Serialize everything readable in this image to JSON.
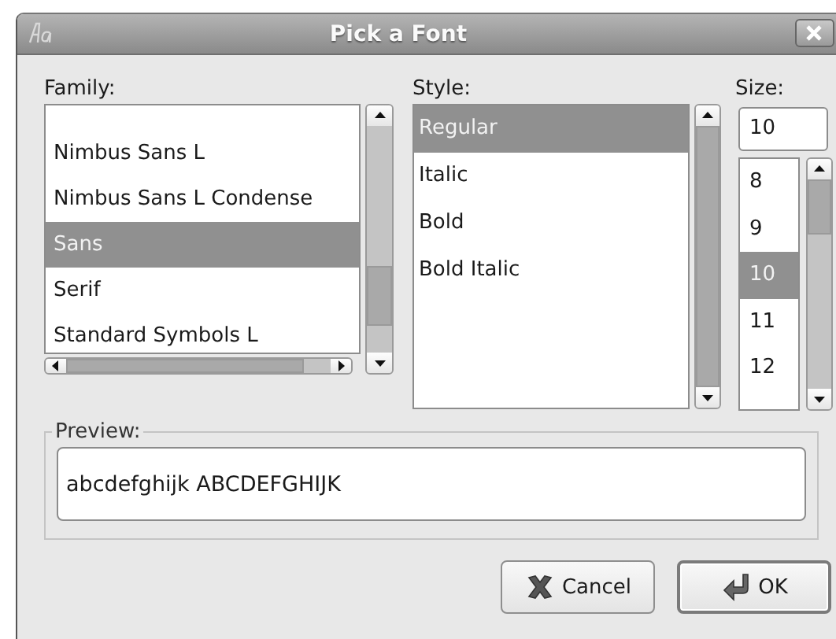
{
  "window": {
    "title": "Pick a Font"
  },
  "family": {
    "label": "Family:",
    "items": [
      {
        "name": "Nimbus Sans L",
        "selected": false
      },
      {
        "name": "Nimbus Sans L Condense",
        "selected": false
      },
      {
        "name": "Sans",
        "selected": true
      },
      {
        "name": "Serif",
        "selected": false
      },
      {
        "name": "Standard Symbols L",
        "selected": false
      }
    ]
  },
  "style": {
    "label": "Style:",
    "items": [
      {
        "name": "Regular",
        "selected": true
      },
      {
        "name": "Italic",
        "selected": false
      },
      {
        "name": "Bold",
        "selected": false
      },
      {
        "name": "Bold Italic",
        "selected": false
      }
    ]
  },
  "size": {
    "label": "Size:",
    "value": "10",
    "items": [
      {
        "name": "8",
        "selected": false
      },
      {
        "name": "9",
        "selected": false
      },
      {
        "name": "10",
        "selected": true
      },
      {
        "name": "11",
        "selected": false
      },
      {
        "name": "12",
        "selected": false
      }
    ]
  },
  "preview": {
    "label": "Preview:",
    "text": "abcdefghijk ABCDEFGHIJK"
  },
  "buttons": [
    {
      "label": "Cancel",
      "kind": "cancel",
      "default": false
    },
    {
      "label": "OK",
      "kind": "ok",
      "default": true
    }
  ]
}
